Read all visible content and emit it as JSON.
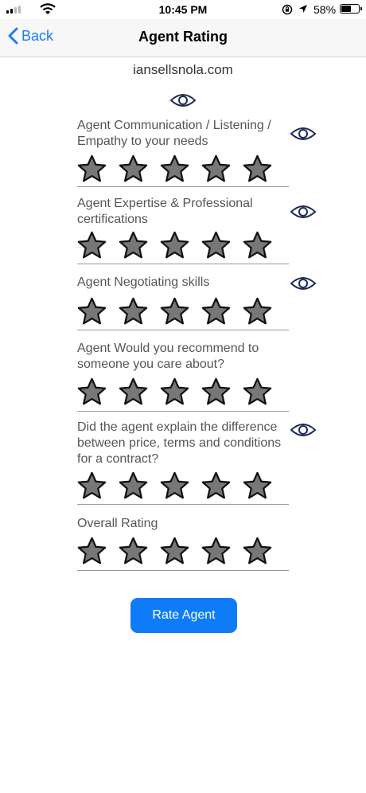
{
  "status_bar": {
    "time": "10:45 PM",
    "battery": "58%"
  },
  "nav": {
    "back_label": "Back",
    "title": "Agent Rating"
  },
  "agent": {
    "domain": "iansellsnola.com"
  },
  "ratings": [
    {
      "label": "Agent Communication / Listening / Empathy to your needs",
      "stars_max": 5
    },
    {
      "label": "Agent Expertise & Professional certifications",
      "stars_max": 5
    },
    {
      "label": "Agent Negotiating skills",
      "stars_max": 5
    },
    {
      "label": "Agent Would you recommend to someone you care about?",
      "stars_max": 5
    },
    {
      "label": "Did the agent explain the difference between price, terms and conditions for a contract?",
      "stars_max": 5
    },
    {
      "label": "Overall Rating",
      "stars_max": 5
    }
  ],
  "actions": {
    "rate_label": "Rate Agent"
  },
  "colors": {
    "accent": "#1a7cf5",
    "button": "#0f7cf7",
    "star_fill": "#777777",
    "eye_stroke": "#1f2a55"
  }
}
